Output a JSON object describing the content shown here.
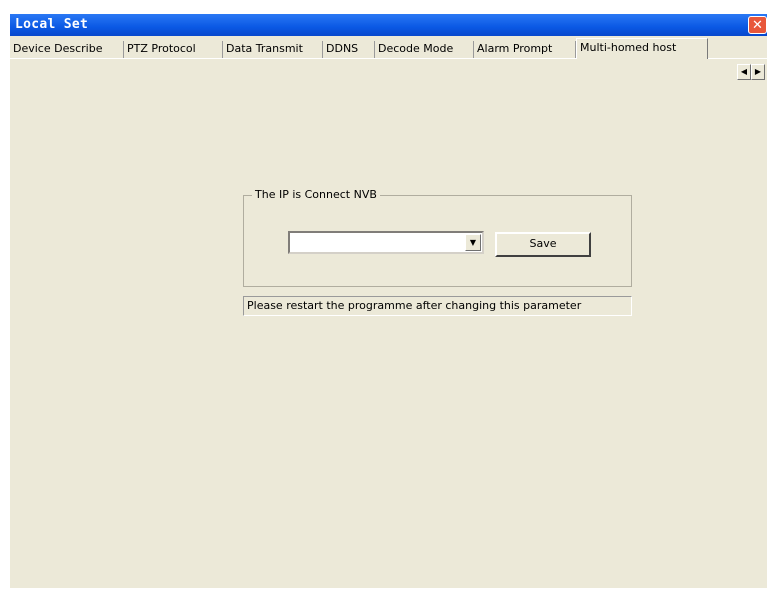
{
  "window": {
    "title": "Local Set",
    "close_glyph": "✕"
  },
  "tabs": [
    {
      "label": "Device Describe"
    },
    {
      "label": "PTZ Protocol"
    },
    {
      "label": "Data Transmit"
    },
    {
      "label": "DDNS"
    },
    {
      "label": "Decode Mode"
    },
    {
      "label": "Alarm Prompt"
    },
    {
      "label": "Multi-homed host",
      "active": true
    }
  ],
  "tab_scroll": {
    "left_glyph": "◀",
    "right_glyph": "▶"
  },
  "group": {
    "label": "The IP is Connect NVB",
    "ip_select_value": "",
    "dropdown_glyph": "▼",
    "save_label": "Save"
  },
  "status_text": "Please restart the programme after changing this parameter",
  "colors": {
    "title_bar": "#0a58e4",
    "window_bg": "#ece9d8",
    "close_button": "#e8573a"
  }
}
